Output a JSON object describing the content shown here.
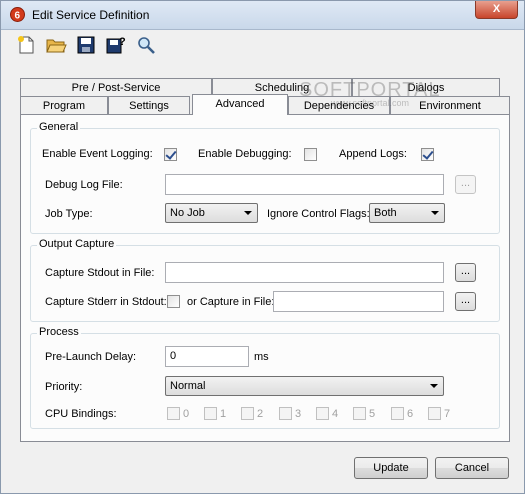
{
  "window": {
    "title": "Edit Service Definition",
    "close_label": "X"
  },
  "toolbar": {
    "icons": [
      "new-icon",
      "open-icon",
      "save-icon",
      "save-as-icon",
      "find-icon"
    ]
  },
  "tabs": {
    "row1": [
      "Pre / Post-Service",
      "Scheduling",
      "Dialogs"
    ],
    "row2": [
      "Program",
      "Settings",
      "Advanced",
      "Dependencies",
      "Environment"
    ],
    "active": "Advanced"
  },
  "watermark": {
    "brand": "SOFTPORTAL",
    "url": "www.softportal.com"
  },
  "general": {
    "legend": "General",
    "enable_event_logging": "Enable Event Logging:",
    "enable_event_logging_checked": true,
    "enable_debugging": "Enable Debugging:",
    "enable_debugging_checked": false,
    "append_logs": "Append Logs:",
    "append_logs_checked": true,
    "debug_log_file": "Debug Log File:",
    "debug_log_file_value": "",
    "browse": "...",
    "job_type": "Job Type:",
    "job_type_value": "No Job",
    "ignore_control_flags": "Ignore Control Flags:",
    "ignore_control_flags_value": "Both"
  },
  "output_capture": {
    "legend": "Output Capture",
    "capture_stdout": "Capture Stdout in File:",
    "capture_stdout_value": "",
    "capture_stderr": "Capture Stderr in Stdout:",
    "capture_stderr_checked": false,
    "or_capture": "or Capture in File:",
    "or_capture_value": "",
    "browse": "..."
  },
  "process": {
    "legend": "Process",
    "pre_launch_delay": "Pre-Launch Delay:",
    "pre_launch_delay_value": "0",
    "ms": "ms",
    "priority": "Priority:",
    "priority_value": "Normal",
    "cpu_bindings": "CPU Bindings:",
    "cpus": [
      "0",
      "1",
      "2",
      "3",
      "4",
      "5",
      "6",
      "7"
    ]
  },
  "footer": {
    "update": "Update",
    "cancel": "Cancel"
  }
}
